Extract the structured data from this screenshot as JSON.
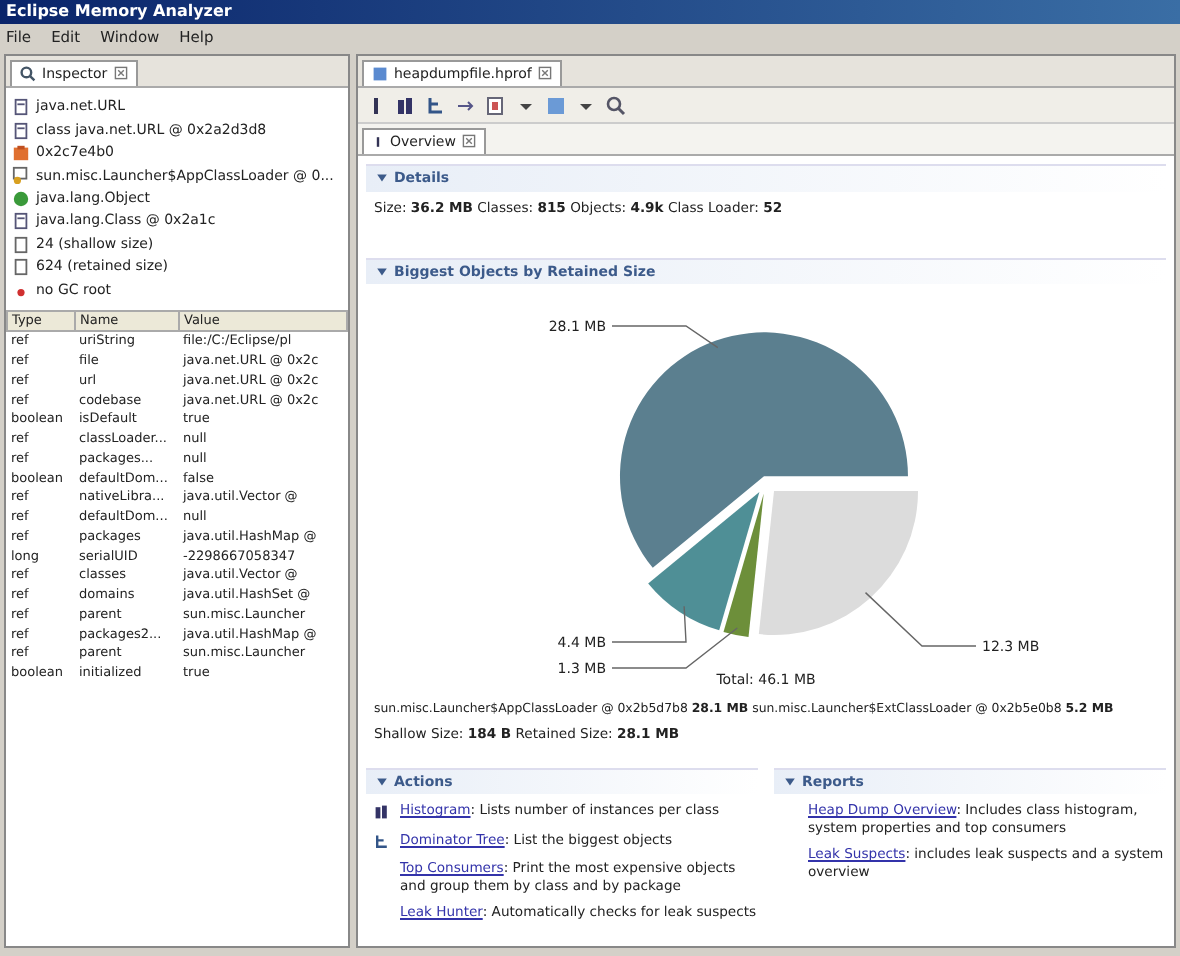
{
  "window": {
    "title": "Eclipse Memory Analyzer"
  },
  "menu": [
    "File",
    "Edit",
    "Window",
    "Help"
  ],
  "inspector": {
    "tab": "Inspector",
    "items": [
      {
        "kind": "class",
        "text": "java.net.URL"
      },
      {
        "kind": "class",
        "text": "class java.net.URL @ 0x2a2d3d8"
      },
      {
        "kind": "object",
        "text": "0x2c7e4b0"
      },
      {
        "kind": "loader",
        "text": "sun.misc.Launcher$AppClassLoader @ 0..."
      },
      {
        "kind": "super",
        "text": "java.lang.Object"
      },
      {
        "kind": "class",
        "text": "java.lang.Class @ 0x2a1c"
      },
      {
        "kind": "size",
        "text": "24 (shallow size)"
      },
      {
        "kind": "size",
        "text": "624 (retained size)"
      },
      {
        "kind": "root",
        "text": "no GC root"
      }
    ],
    "columns": [
      "Type",
      "Name",
      "Value"
    ],
    "rows": [
      [
        "ref",
        "uriString",
        "file:/C:/Eclipse/pl"
      ],
      [
        "ref",
        "file",
        "java.net.URL @ 0x2c"
      ],
      [
        "ref",
        "url",
        "java.net.URL @ 0x2c"
      ],
      [
        "ref",
        "codebase",
        "java.net.URL @ 0x2c"
      ],
      [
        "boolean",
        "isDefault",
        "true"
      ],
      [
        "ref",
        "classLoader...",
        "null"
      ],
      [
        "ref",
        "packages...",
        "null"
      ],
      [
        "boolean",
        "defaultDom...",
        "false"
      ],
      [
        "ref",
        "nativeLibra...",
        "java.util.Vector @"
      ],
      [
        "ref",
        "defaultDom...",
        "null"
      ],
      [
        "ref",
        "packages",
        "java.util.HashMap @"
      ],
      [
        "long",
        "serialUID",
        "-2298667058347"
      ],
      [
        "ref",
        "classes",
        "java.util.Vector @"
      ],
      [
        "ref",
        "domains",
        "java.util.HashSet @"
      ],
      [
        "ref",
        "parent",
        "sun.misc.Launcher"
      ],
      [
        "ref",
        "packages2...",
        "java.util.HashMap @"
      ],
      [
        "ref",
        "parent",
        "sun.misc.Launcher"
      ],
      [
        "boolean",
        "initialized",
        "true"
      ]
    ]
  },
  "editor": {
    "tab": "heapdumpfile.hprof",
    "subtab": "Overview",
    "details": {
      "title": "Details",
      "text": "Size: **36.2 MB** Classes: **815** Objects: **4.9k** Class Loader: **52**"
    },
    "biggest": {
      "title": "Biggest Objects by Retained Size",
      "chart_data": {
        "type": "pie",
        "categories": [
          "12.3 MB",
          "1.3 MB",
          "4.4 MB",
          "28.1 MB"
        ],
        "series": [
          {
            "values": [
              12.3,
              1.3,
              4.4,
              28.1
            ]
          }
        ]
      },
      "slices": [
        {
          "color": "#dcdcdc"
        },
        {
          "color": "#6d8f3a"
        },
        {
          "color": "#4f8f96"
        },
        {
          "color": "#5b7f8f"
        }
      ],
      "total": "Total: 46.1 MB",
      "legend": "sun.misc.Launcher$AppClassLoader @ 0x2b5d7b8 **28.1 MB**  sun.misc.Launcher$ExtClassLoader @ 0x2b5e0b8 **5.2 MB**",
      "sizes": "Shallow Size: **184 B** Retained Size: **28.1 MB**"
    },
    "actions": {
      "title": "Actions",
      "items": [
        {
          "kind": "histogram",
          "link": "Histogram",
          "desc": ": Lists number of instances per class"
        },
        {
          "kind": "tree",
          "link": "Dominator Tree",
          "desc": ": List the biggest objects"
        },
        {
          "kind": "plain",
          "link": "Top Consumers",
          "desc": ": Print the most expensive objects and group them by class and by package"
        },
        {
          "kind": "plain",
          "link": "Leak Hunter",
          "desc": ": Automatically checks for leak suspects"
        }
      ]
    },
    "reports": {
      "title": "Reports",
      "items": [
        {
          "link": "Heap Dump Overview",
          "desc": ": Includes class histogram, system properties and top consumers"
        },
        {
          "link": "Leak Suspects",
          "desc": ": includes leak suspects and a system overview"
        }
      ]
    }
  }
}
